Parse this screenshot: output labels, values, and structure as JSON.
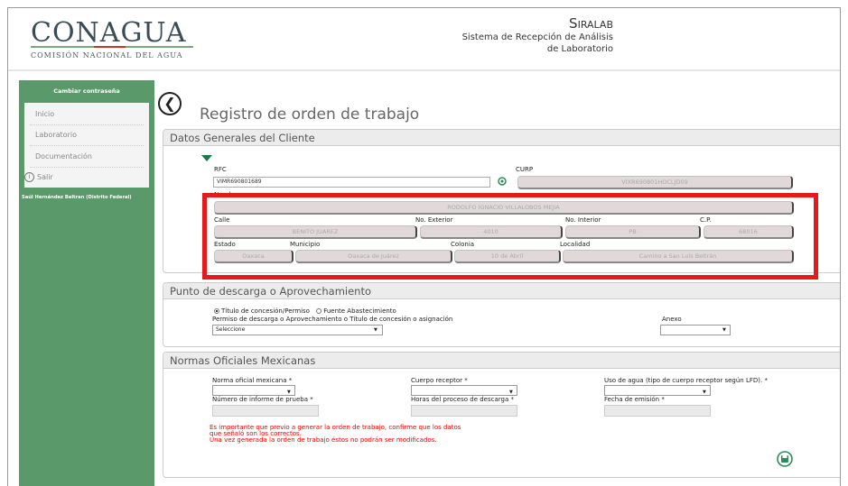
{
  "header": {
    "logo_title": "CONAGUA",
    "logo_subtitle": "COMISIÓN NACIONAL DEL AGUA",
    "app_name": "Siralab",
    "app_subtitle_line1": "Sistema de Recepción de Análisis",
    "app_subtitle_line2": "de Laboratorio"
  },
  "sidebar": {
    "change_password": "Cambiar contraseña",
    "items": [
      {
        "label": "Inicio"
      },
      {
        "label": "Laboratorio"
      },
      {
        "label": "Documentación"
      },
      {
        "label": "Salir"
      }
    ],
    "user": "Saúl Hernández Beltran (Distrito Federal)"
  },
  "main": {
    "title": "Registro de orden de trabajo"
  },
  "client": {
    "heading": "Datos Generales del Cliente",
    "rfc_label": "RFC",
    "rfc_value": "VIMR690801689",
    "curp_label": "CURP",
    "curp_value": "VIXR690801HOCLJD09",
    "nombre_label": "Nombre",
    "nombre_value": "RODOLFO IGNACIO VILLALOBOS MEJIA",
    "calle_label": "Calle",
    "calle_value": "BENITO JUAREZ",
    "num_ext_label": "No. Exterior",
    "num_ext_value": "4010",
    "num_int_label": "No. Interior",
    "num_int_value": "PB",
    "cp_label": "C.P.",
    "cp_value": "68016",
    "estado_label": "Estado",
    "estado_value": "Oaxaca",
    "municipio_label": "Municipio",
    "municipio_value": "Oaxaca de Juárez",
    "colonia_label": "Colonia",
    "colonia_value": "10 de Abril",
    "localidad_label": "Localidad",
    "localidad_value": "Camino a San Luis Beltrán"
  },
  "discharge": {
    "heading": "Punto de descarga o Aprovechamiento",
    "radio1_label": "Título de concesión/Permiso",
    "radio2_label": "Fuente Abastecimiento",
    "permit_label": "Permiso de descarga o Aprovechamiento o Título de concesión o asignación",
    "permit_value": "Seleccione",
    "anexo_label": "Anexo",
    "anexo_value": ""
  },
  "norms": {
    "heading": "Normas Oficiales Mexicanas",
    "norma_label": "Norma oficial mexicana *",
    "cuerpo_label": "Cuerpo receptor *",
    "uso_label": "Uso de agua (tipo de cuerpo receptor según LFD). *",
    "informe_label": "Número de informe de prueba *",
    "horas_label": "Horas del proceso de descarga *",
    "fecha_label": "Fecha de emisión *",
    "warning_line1": "Es importante que previo a generar la orden de trabajo, confirme que los datos",
    "warning_line2": " que señaló son los correctos.",
    "warning_line3": "Una vez generada la orden de trabajo éstos no podrán ser modificados."
  },
  "colors": {
    "sidebar": "#5a9a6a",
    "highlight": "#e41b1b",
    "save_icon": "#2e8b57"
  },
  "icons": [
    "back-arrow-icon",
    "locate-icon",
    "info-icon",
    "save-icon",
    "chevron-down-icon"
  ]
}
